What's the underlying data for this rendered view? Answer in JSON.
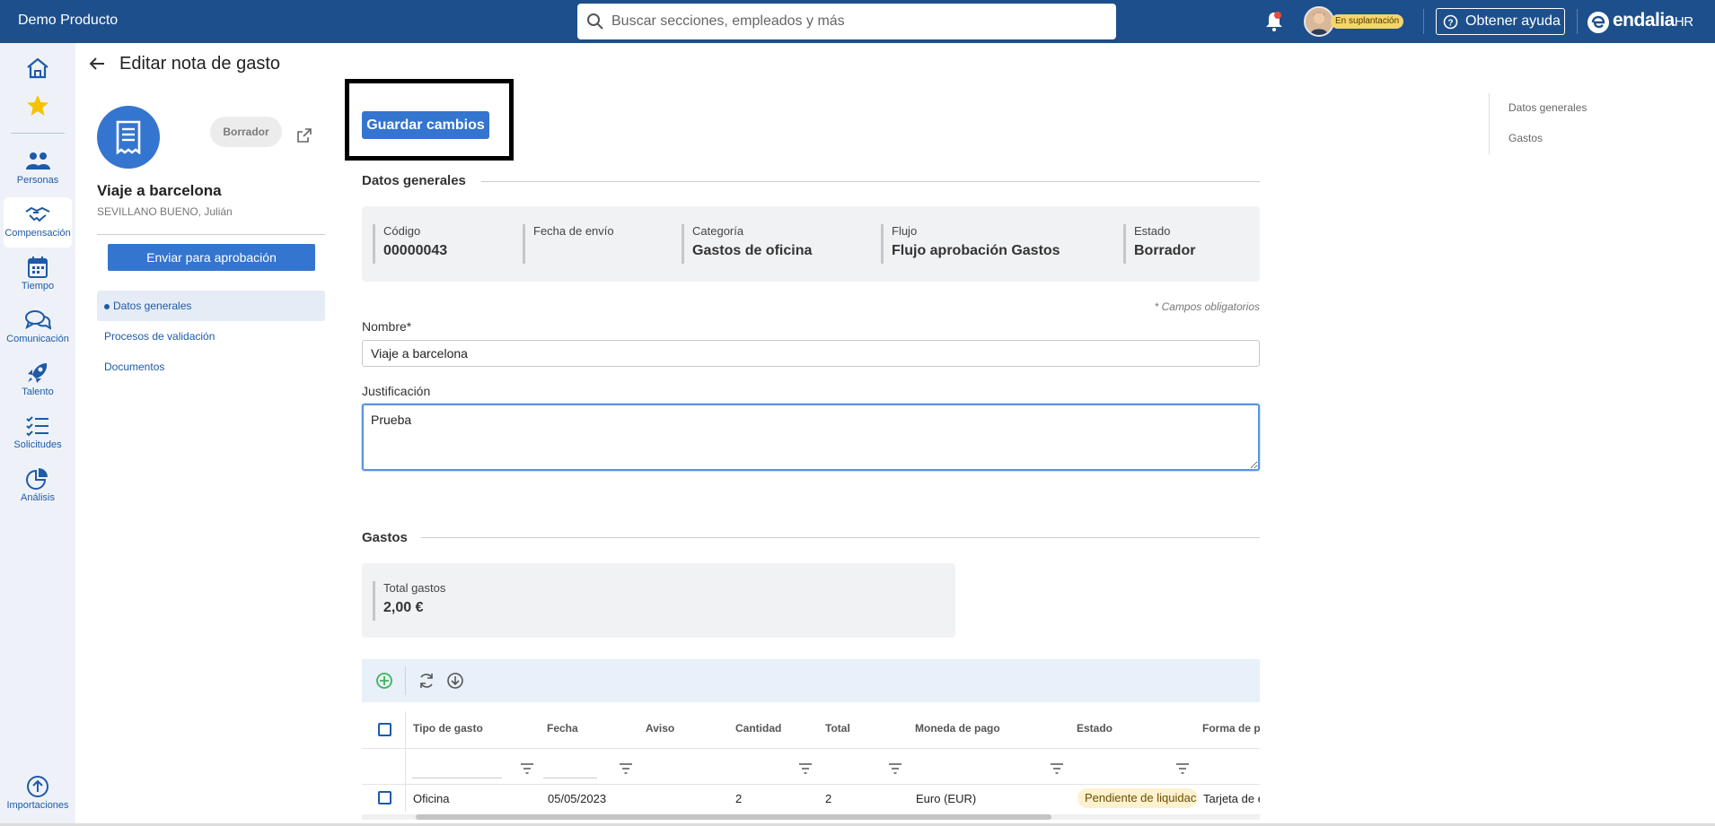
{
  "topbar": {
    "app_name": "Demo Producto",
    "search_placeholder": "Buscar secciones, empleados y más",
    "impersonation_badge": "En suplantación",
    "help_label": "Obtener ayuda",
    "brand_name": "endalia",
    "brand_suffix": "HR",
    "icons": [
      "search-icon",
      "bell-icon",
      "help-icon",
      "endalia-logo"
    ],
    "accent_color": "#1d4f8c"
  },
  "leftnav": {
    "items": [
      {
        "label": "",
        "icon": "home-icon"
      },
      {
        "label": "",
        "icon": "star-icon"
      },
      {
        "label": "Personas",
        "icon": "people-icon"
      },
      {
        "label": "Compensación",
        "icon": "handshake-icon",
        "active": true
      },
      {
        "label": "Tiempo",
        "icon": "calendar-icon"
      },
      {
        "label": "Comunicación",
        "icon": "chat-icon"
      },
      {
        "label": "Talento",
        "icon": "rocket-icon"
      },
      {
        "label": "Solicitudes",
        "icon": "checklist-icon"
      },
      {
        "label": "Análisis",
        "icon": "pie-chart-icon"
      },
      {
        "label": "Importaciones",
        "icon": "upload-icon"
      }
    ]
  },
  "page": {
    "title": "Editar nota de gasto"
  },
  "record": {
    "status": "Borrador",
    "title": "Viaje a barcelona",
    "owner": "SEVILLANO BUENO, Julián",
    "send_label": "Enviar para aprobación",
    "sections": [
      "Datos generales",
      "Procesos de validación",
      "Documentos"
    ]
  },
  "main": {
    "save_label": "Guardar cambios",
    "general_title": "Datos generales",
    "info": [
      {
        "label": "Código",
        "value": "00000043"
      },
      {
        "label": "Fecha de envío",
        "value": ""
      },
      {
        "label": "Categoría",
        "value": "Gastos de oficina"
      },
      {
        "label": "Flujo",
        "value": "Flujo aprobación Gastos"
      },
      {
        "label": "Estado",
        "value": "Borrador"
      }
    ],
    "required_note": "* Campos obligatorios",
    "name_label": "Nombre*",
    "name_value": "Viaje a barcelona",
    "justification_label": "Justificación",
    "justification_value": "Prueba",
    "expenses_title": "Gastos",
    "total_label": "Total gastos",
    "total_value": "2,00 €"
  },
  "grid": {
    "columns": [
      "Tipo de gasto",
      "Fecha",
      "Aviso",
      "Cantidad",
      "Total",
      "Moneda de pago",
      "Estado",
      "Forma de pa"
    ],
    "rows": [
      {
        "tipo": "Oficina",
        "fecha": "05/05/2023",
        "aviso": "",
        "cantidad": "2",
        "total": "2",
        "moneda": "Euro (EUR)",
        "estado": "Pendiente de liquidac",
        "forma": "Tarjeta de e"
      }
    ],
    "status_color": "#fdf1cf",
    "scroll_position": 0.06
  },
  "toc": {
    "items": [
      "Datos generales",
      "Gastos"
    ]
  }
}
